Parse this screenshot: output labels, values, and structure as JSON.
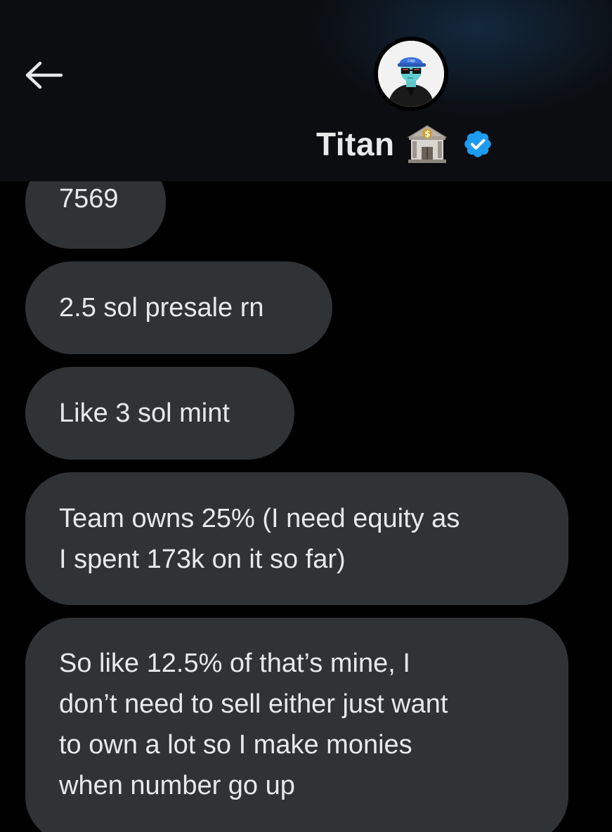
{
  "header": {
    "name": "Titan",
    "back_icon": "arrow-left-icon",
    "avatar_icon": "avatar-profile-icon",
    "bank_emoji_icon": "bank-emoji-icon",
    "verified_icon": "verified-badge-icon",
    "verified_color": "#1d9bf0"
  },
  "messages": [
    {
      "text": "7569"
    },
    {
      "text": "2.5 sol presale rn"
    },
    {
      "text": "Like 3 sol mint"
    },
    {
      "text": "Team owns 25% (I need equity as\nI spent 173k on it so far)"
    },
    {
      "text": "So like 12.5% of that’s mine, I\ndon’t need to sell either just want\nto own a lot so I make monies\nwhen number go up"
    }
  ],
  "colors": {
    "background": "#000000",
    "bubble": "#2f3336",
    "text": "#e7e9ea"
  }
}
